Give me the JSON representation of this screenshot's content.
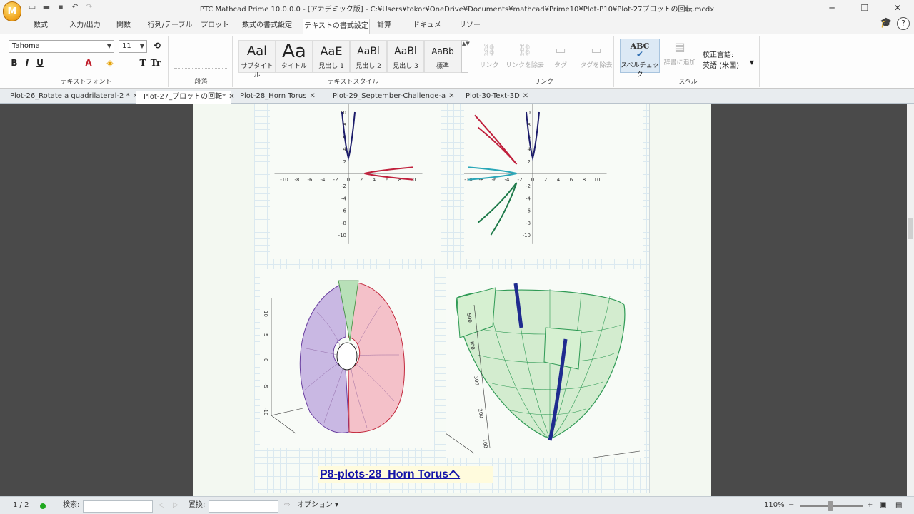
{
  "window": {
    "title": "PTC Mathcad Prime 10.0.0.0 - [アカデミック版] - C:¥Users¥tokor¥OneDrive¥Documents¥mathcad¥Prime10¥Plot-P10¥Plot-27プロットの回転.mcdx",
    "logo_letter": "M"
  },
  "menu_tabs": [
    "数式",
    "入力/出力",
    "関数",
    "行列/テーブル",
    "プロット",
    "数式の書式設定",
    "テキストの書式設定",
    "計算",
    "ドキュメント",
    "リソース"
  ],
  "active_menu_tab": "テキストの書式設定",
  "ribbon": {
    "font": {
      "name": "Tahoma",
      "size": "11",
      "group_label": "テキストフォント"
    },
    "paragraph": {
      "group_label": "段落"
    },
    "text_styles": {
      "group_label": "テキストスタイル",
      "tiles": [
        {
          "preview": "Aal",
          "label": "サブタイトル"
        },
        {
          "preview": "Aa",
          "label": "タイトル"
        },
        {
          "preview": "AaE",
          "label": "見出し 1"
        },
        {
          "preview": "AaBl",
          "label": "見出し 2"
        },
        {
          "preview": "AaBl",
          "label": "見出し 3"
        },
        {
          "preview": "AaBb",
          "label": "標準"
        }
      ]
    },
    "link": {
      "group_label": "リンク",
      "buttons": [
        "リンク",
        "リンクを除去",
        "タグ",
        "タグを除去"
      ]
    },
    "spell": {
      "group_label": "スペル",
      "check_label": "スペルチェック",
      "check_icon_text": "ABC",
      "dictionary_label": "辞書に追加",
      "language_label": "校正言語:",
      "language_value": "英語 (米国)"
    }
  },
  "doc_tabs": [
    {
      "label": "Plot-26_Rotate a quadrilateral-2 *"
    },
    {
      "label": "Plot-27_プロットの回転*"
    },
    {
      "label": "Plot-28_Horn Torus"
    },
    {
      "label": "Plot-29_September-Challenge-a"
    },
    {
      "label": "Plot-30-Text-3D"
    }
  ],
  "active_doc_tab": 1,
  "hyperlink_text": "P8-plots-28_Horn Torusへ",
  "chart_data": [
    {
      "type": "line",
      "x_ticks": [
        -10,
        -8,
        -6,
        -4,
        -2,
        0,
        2,
        4,
        6,
        8,
        10
      ],
      "y_ticks": [
        10,
        8,
        6,
        4,
        2,
        -2,
        -4,
        -6,
        -8,
        -10
      ],
      "series": [
        {
          "color": "#1d1d6b",
          "equation_shape": "parabola opening up",
          "x": [
            -1,
            -0.5,
            0,
            0.5,
            1
          ],
          "y": [
            10,
            4.5,
            2.5,
            4.5,
            10
          ]
        },
        {
          "color": "#c0203c",
          "equation_shape": "parabola opening right",
          "x": [
            10,
            4.5,
            2.5,
            4.5,
            10
          ],
          "y": [
            1,
            0.5,
            0,
            -0.5,
            -1
          ]
        }
      ]
    },
    {
      "type": "line",
      "x_ticks": [
        -10,
        -8,
        -6,
        -4,
        -2,
        0,
        2,
        4,
        6,
        8,
        10
      ],
      "y_ticks": [
        10,
        8,
        6,
        4,
        2,
        -2,
        -4,
        -6,
        -8,
        -10
      ],
      "series": [
        {
          "color": "#1d1d6b",
          "x": [
            -1,
            -0.5,
            0,
            0.5,
            1
          ],
          "y": [
            10,
            4.5,
            2.5,
            4.5,
            10
          ]
        },
        {
          "color": "#c0203c",
          "x": [
            -8.5,
            -5,
            -2.5,
            -6,
            -9
          ],
          "y": [
            7.5,
            4.5,
            1.5,
            6,
            9.5
          ]
        },
        {
          "color": "#2aa7b8",
          "x": [
            -10,
            -5,
            -2.5,
            -5,
            -10
          ],
          "y": [
            1,
            0.6,
            0,
            -0.6,
            -1
          ]
        },
        {
          "color": "#1e7a4a",
          "x": [
            -8.5,
            -5,
            -2.5,
            -4,
            -6.5
          ],
          "y": [
            -8,
            -5,
            -1.5,
            -6,
            -10
          ]
        }
      ]
    }
  ],
  "plot3d_left": {
    "surface_colors": [
      "#8b5fbf",
      "#e05a6a",
      "#7cc47c"
    ],
    "z_ticks": [
      "10",
      "5",
      "0",
      "-5",
      "-10"
    ]
  },
  "plot3d_right": {
    "surface_color": "#3aa860",
    "curve_color": "#1f2b8f",
    "z_ticks": [
      "500",
      "400",
      "300",
      "200",
      "100"
    ]
  },
  "status": {
    "page": "1 / 2",
    "search_label": "検索:",
    "replace_label": "置換:",
    "options_label": "オプション",
    "zoom": "110%"
  }
}
